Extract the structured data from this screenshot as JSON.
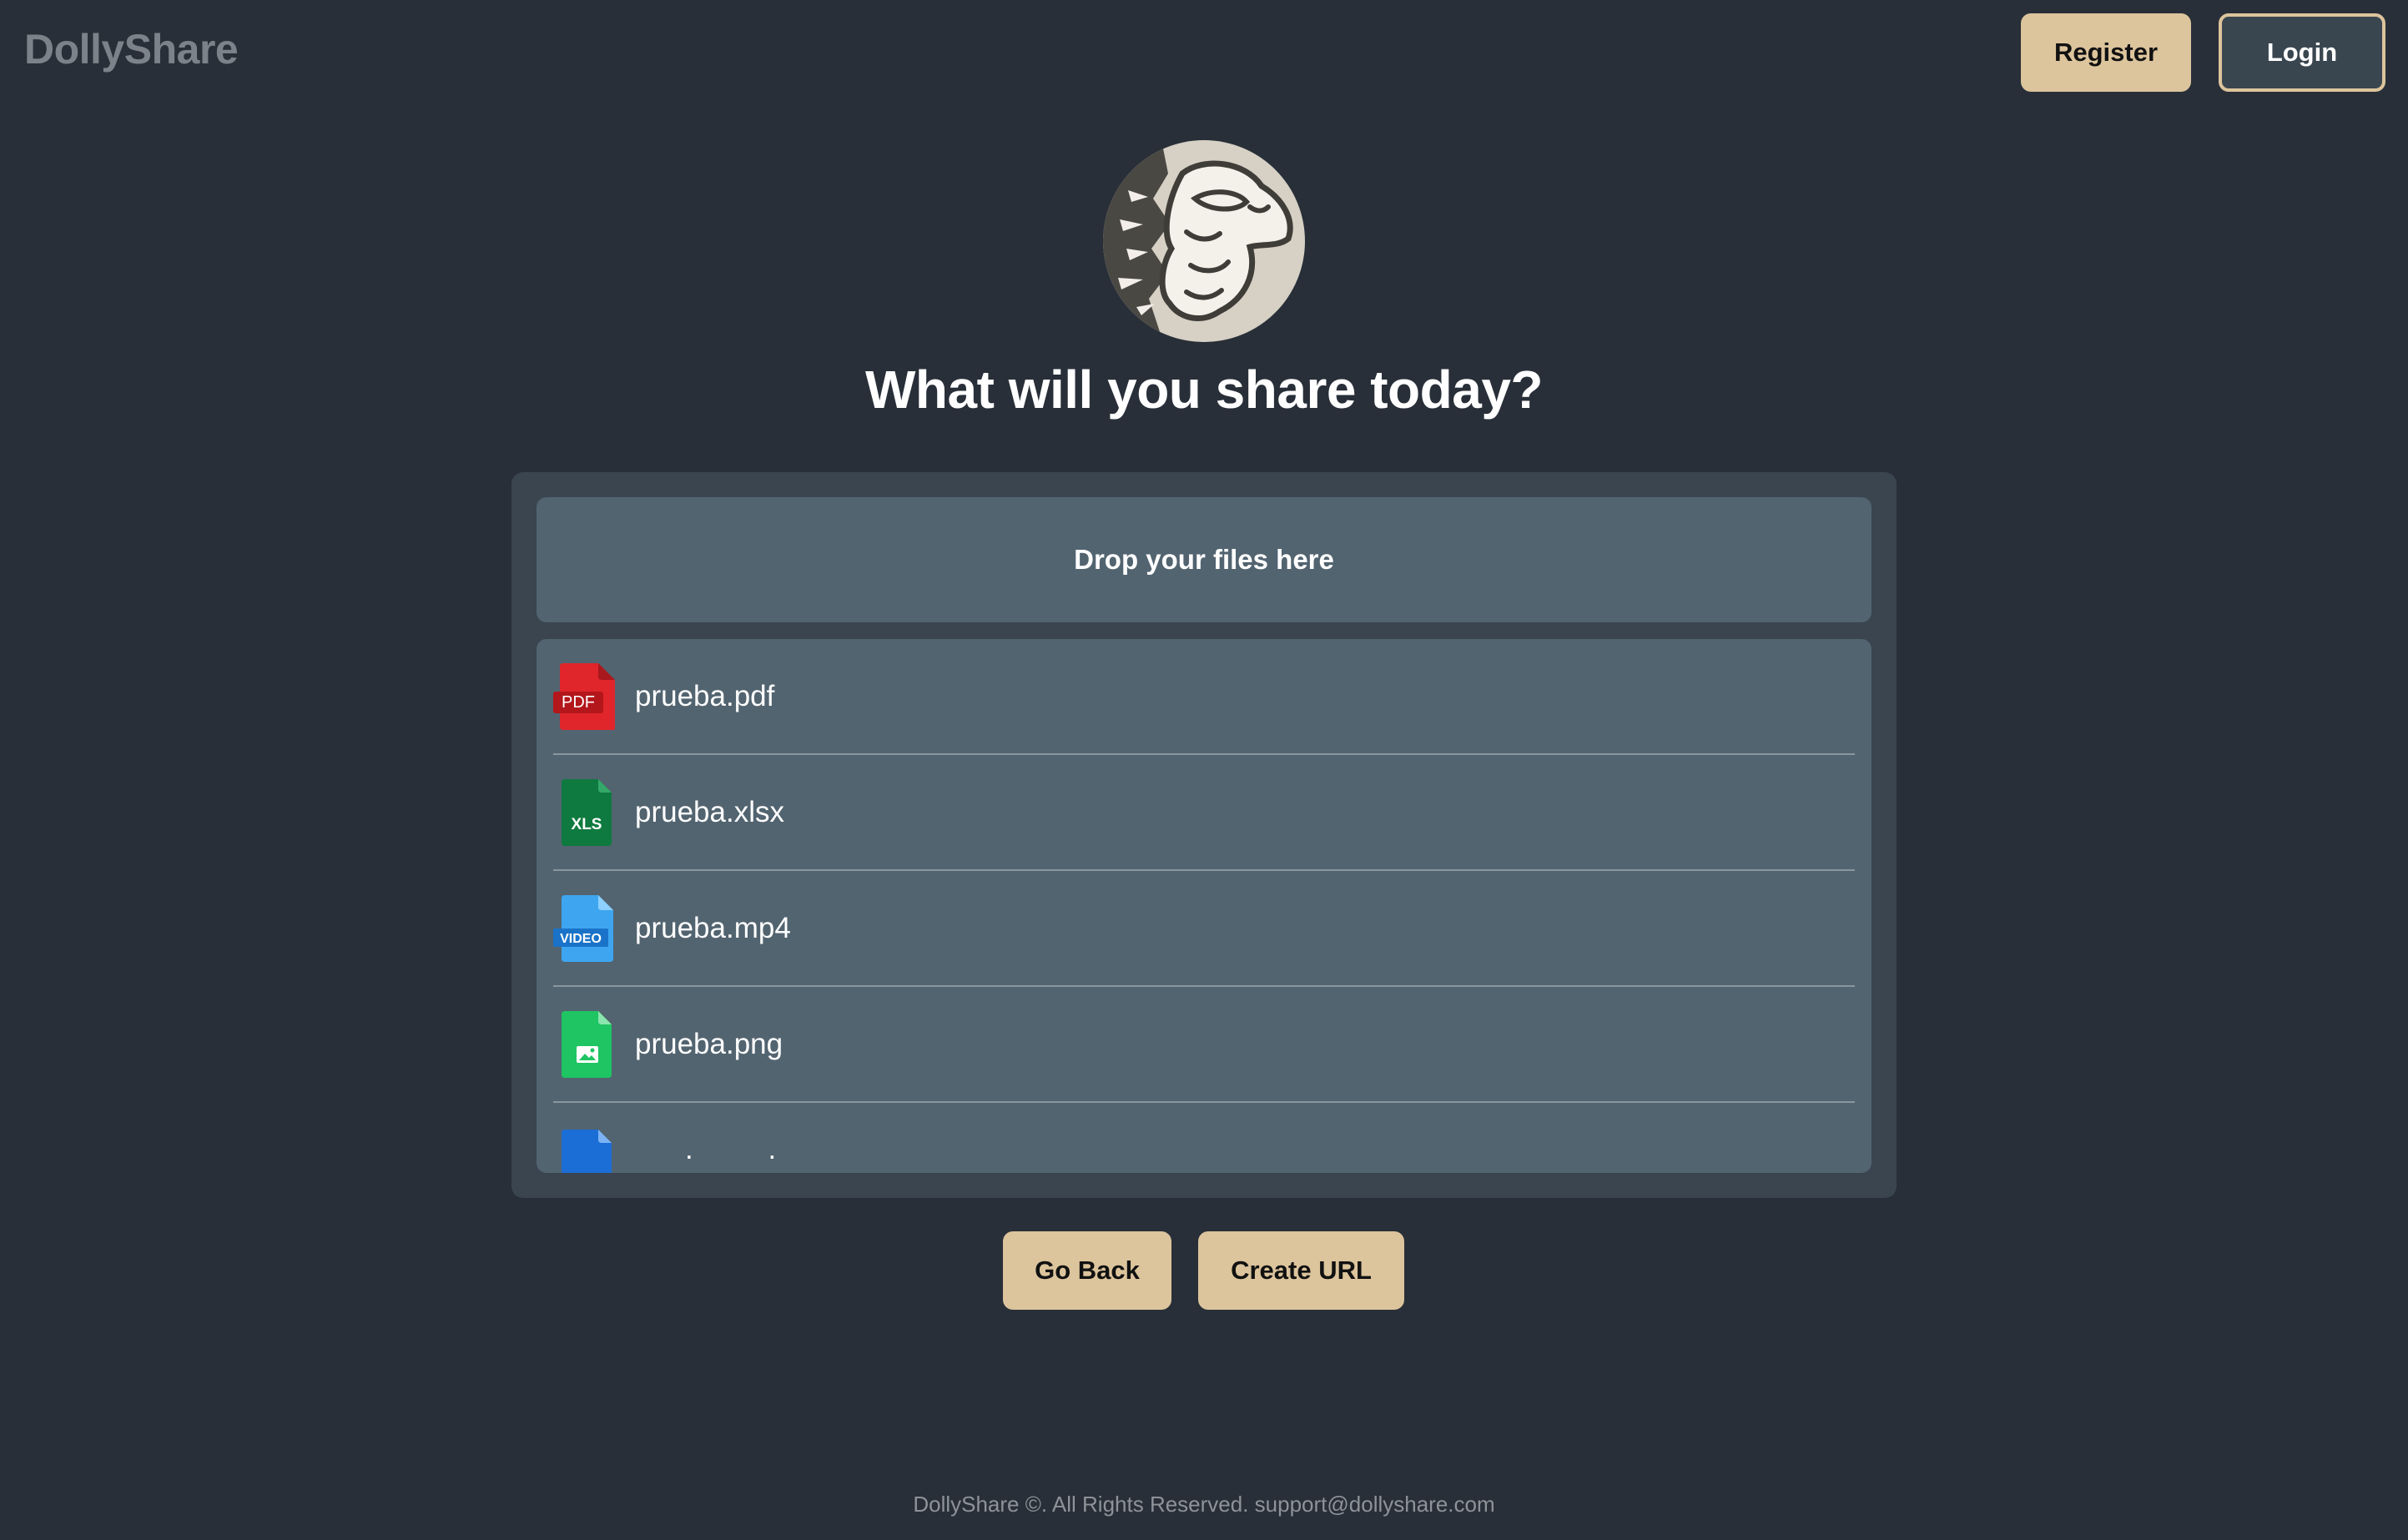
{
  "header": {
    "brand": "DollyShare",
    "register_label": "Register",
    "login_label": "Login"
  },
  "hero": {
    "headline": "What will you share today?"
  },
  "upload": {
    "dropzone_label": "Drop your files here",
    "files": [
      {
        "name": "prueba.pdf",
        "icon": "pdf-file-icon",
        "badge": "PDF",
        "color": "#e0262b"
      },
      {
        "name": "prueba.xlsx",
        "icon": "xls-file-icon",
        "badge": "XLS",
        "color": "#0e7a3f"
      },
      {
        "name": "prueba.mp4",
        "icon": "video-file-icon",
        "badge": "VIDEO",
        "color": "#3ea6f0"
      },
      {
        "name": "prueba.png",
        "icon": "image-file-icon",
        "badge": "",
        "color": "#1fc463"
      },
      {
        "name": ". .",
        "icon": "doc-file-icon",
        "badge": "",
        "color": "#1b6ed6"
      }
    ]
  },
  "actions": {
    "go_back_label": "Go Back",
    "create_url_label": "Create URL"
  },
  "footer": {
    "text": "DollyShare ©. All Rights Reserved. support@dollyshare.com"
  },
  "colors": {
    "background": "#282f38",
    "panel": "#3a454f",
    "list": "#526470",
    "accent": "#dcc49c"
  }
}
